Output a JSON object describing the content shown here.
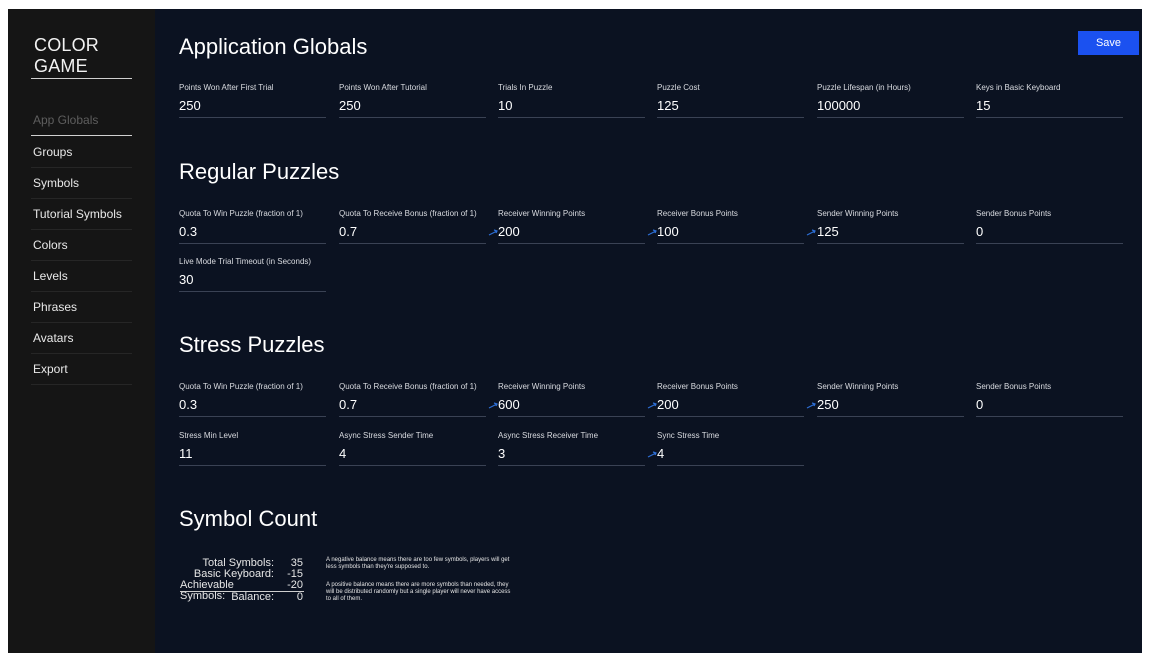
{
  "sidebar": {
    "brand": "COLOR GAME",
    "items": [
      {
        "label": "App Globals",
        "active": true
      },
      {
        "label": "Groups"
      },
      {
        "label": "Symbols"
      },
      {
        "label": "Tutorial Symbols"
      },
      {
        "label": "Colors"
      },
      {
        "label": "Levels"
      },
      {
        "label": "Phrases"
      },
      {
        "label": "Avatars"
      },
      {
        "label": "Export"
      }
    ]
  },
  "toolbar": {
    "save_label": "Save"
  },
  "colors": {
    "accent": "#1b51f0",
    "background": "#0b1221",
    "sidebar": "#151515",
    "spin_icon": "#2d6fd6"
  },
  "app_globals": {
    "title": "Application Globals",
    "fields": [
      {
        "label": "Points Won After First Trial",
        "value": "250"
      },
      {
        "label": "Points Won After Tutorial",
        "value": "250"
      },
      {
        "label": "Trials In Puzzle",
        "value": "10"
      },
      {
        "label": "Puzzle Cost",
        "value": "125"
      },
      {
        "label": "Puzzle Lifespan (in Hours)",
        "value": "100000"
      },
      {
        "label": "Keys in Basic Keyboard",
        "value": "15"
      }
    ]
  },
  "regular": {
    "title": "Regular Puzzles",
    "fields": [
      {
        "label": "Quota To Win Puzzle (fraction of 1)",
        "value": "0.3"
      },
      {
        "label": "Quota To Receive Bonus (fraction of 1)",
        "value": "0.7"
      },
      {
        "label": "Receiver Winning Points",
        "value": "200"
      },
      {
        "label": "Receiver Bonus Points",
        "value": "100"
      },
      {
        "label": "Sender Winning Points",
        "value": "125"
      },
      {
        "label": "Sender Bonus Points",
        "value": "0"
      },
      {
        "label": "Live Mode Trial Timeout (in Seconds)",
        "value": "30"
      }
    ]
  },
  "stress": {
    "title": "Stress Puzzles",
    "fields": [
      {
        "label": "Quota To Win Puzzle (fraction of 1)",
        "value": "0.3"
      },
      {
        "label": "Quota To Receive Bonus (fraction of 1)",
        "value": "0.7"
      },
      {
        "label": "Receiver Winning Points",
        "value": "600"
      },
      {
        "label": "Receiver Bonus Points",
        "value": "200"
      },
      {
        "label": "Sender Winning Points",
        "value": "250"
      },
      {
        "label": "Sender Bonus Points",
        "value": "0"
      },
      {
        "label": "Stress Min Level",
        "value": "11"
      },
      {
        "label": "Async Stress Sender Time",
        "value": "4"
      },
      {
        "label": "Async Stress Receiver Time",
        "value": "3"
      },
      {
        "label": "Sync Stress Time",
        "value": "4"
      }
    ]
  },
  "symbol_count": {
    "title": "Symbol Count",
    "rows": [
      {
        "label": "Total Symbols:",
        "value": "35"
      },
      {
        "label": "Basic Keyboard:",
        "value": "-15"
      },
      {
        "label": "Achievable Symbols:",
        "value": "-20"
      },
      {
        "label": "Balance:",
        "value": "0"
      }
    ],
    "note_negative": "A negative balance means there are too few symbols, players will get less symbols than they're supposed to.",
    "note_positive": "A positive balance means there are more symbols than needed, they will be distributed randomly but a single player will never have access to all of them."
  }
}
